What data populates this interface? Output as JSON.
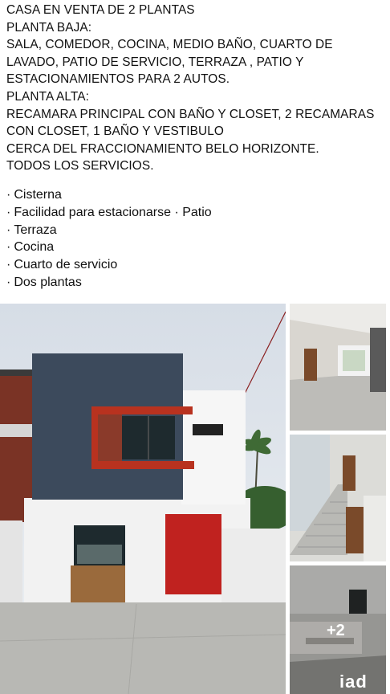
{
  "post": {
    "lines": [
      "CASA EN VENTA DE 2 PLANTAS",
      "PLANTA BAJA:",
      "SALA, COMEDOR, COCINA, MEDIO BAÑO, CUARTO DE LAVADO, PATIO DE SERVICIO, TERRAZA , PATIO Y ESTACIONAMIENTOS PARA 2 AUTOS.",
      "PLANTA ALTA:",
      "RECAMARA PRINCIPAL CON BAÑO Y CLOSET, 2 RECAMARAS CON CLOSET, 1 BAÑO Y VESTIBULO",
      "CERCA DEL FRACCIONAMIENTO BELO HORIZONTE.",
      "TODOS LOS SERVICIOS."
    ],
    "features": [
      "Cisterna",
      "Facilidad para estacionarse · Patio",
      "Terraza",
      "Cocina",
      "Cuarto de servicio",
      "Dos plantas"
    ],
    "bullet": "·"
  },
  "gallery": {
    "more_count": "+2",
    "logo_text": "iad",
    "colors": {
      "facade_gray": "#3c4a5c",
      "door_red": "#c0221f",
      "frame_red": "#b8321f",
      "brick": "#8a3a2a"
    }
  }
}
